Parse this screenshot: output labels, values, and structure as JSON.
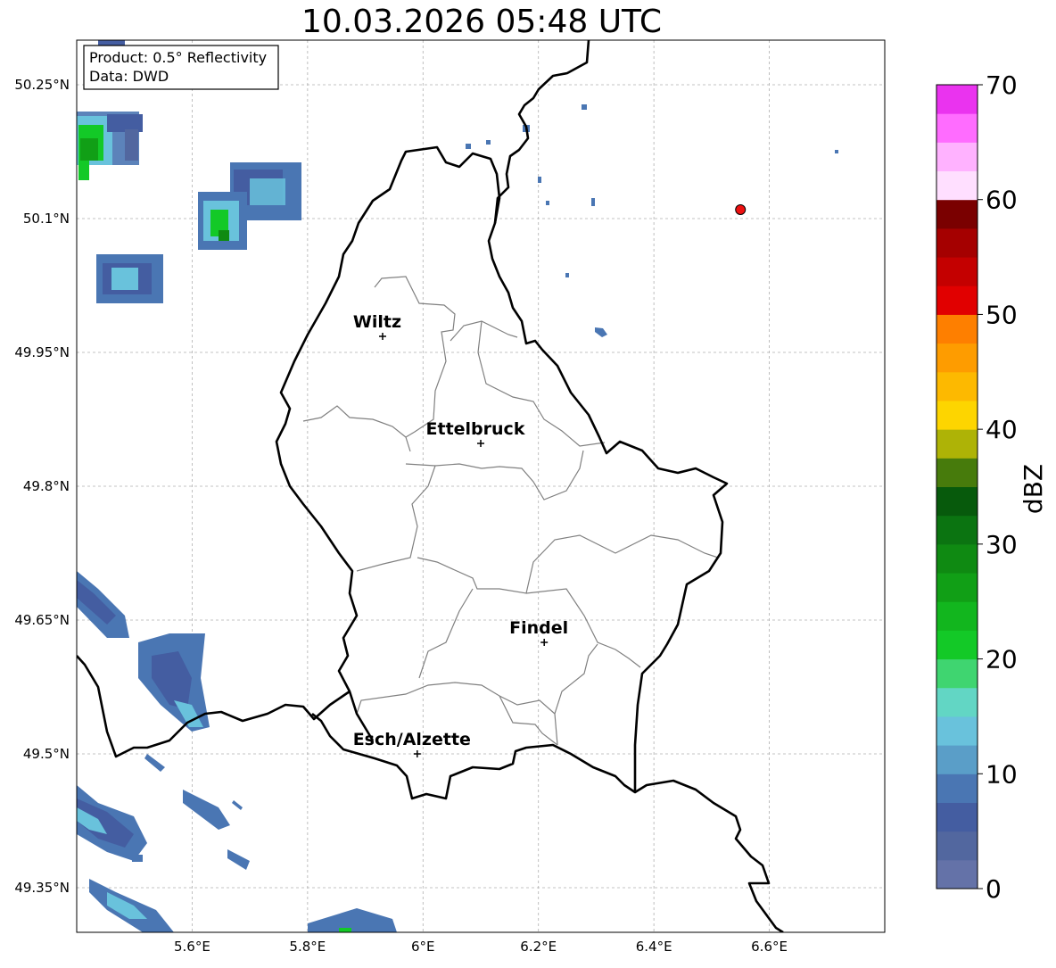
{
  "title": "10.03.2026 05:48 UTC",
  "infobox": {
    "product": "Product: 0.5° Reflectivity",
    "data": "Data: DWD"
  },
  "map": {
    "lon_range": [
      5.4,
      6.8
    ],
    "lat_range": [
      49.3,
      50.3
    ],
    "lon_ticks": [
      {
        "value": 5.6,
        "label": "5.6°E"
      },
      {
        "value": 5.8,
        "label": "5.8°E"
      },
      {
        "value": 6.0,
        "label": "6°E"
      },
      {
        "value": 6.2,
        "label": "6.2°E"
      },
      {
        "value": 6.4,
        "label": "6.4°E"
      },
      {
        "value": 6.6,
        "label": "6.6°E"
      }
    ],
    "lat_ticks": [
      {
        "value": 50.25,
        "label": "50.25°N"
      },
      {
        "value": 50.1,
        "label": "50.1°N"
      },
      {
        "value": 49.95,
        "label": "49.95°N"
      },
      {
        "value": 49.8,
        "label": "49.8°N"
      },
      {
        "value": 49.65,
        "label": "49.65°N"
      },
      {
        "value": 49.5,
        "label": "49.5°N"
      },
      {
        "value": 49.35,
        "label": "49.35°N"
      }
    ],
    "grid": true,
    "cities": [
      {
        "name": "Wiltz",
        "lon": 5.93,
        "lat": 49.968
      },
      {
        "name": "Ettelbruck",
        "lon": 6.1,
        "lat": 49.848
      },
      {
        "name": "Findel",
        "lon": 6.21,
        "lat": 49.625
      },
      {
        "name": "Esch/Alzette",
        "lon": 5.99,
        "lat": 49.5
      }
    ],
    "marker": {
      "lon": 6.55,
      "lat": 50.11,
      "color": "#ee1111"
    }
  },
  "colorbar": {
    "label": "dBZ",
    "ticks": [
      0,
      10,
      20,
      30,
      40,
      50,
      60,
      70
    ],
    "min": 0,
    "max": 70,
    "colors": [
      "#6472a8",
      "#52679f",
      "#445da1",
      "#4a76b3",
      "#5a9ec8",
      "#69c2dc",
      "#62d6c4",
      "#3fd570",
      "#13c927",
      "#12b61e",
      "#119f16",
      "#0f8a12",
      "#0b7411",
      "#075a0c",
      "#477b0c",
      "#aeb306",
      "#fdd500",
      "#fdb900",
      "#fe9c00",
      "#fe7f00",
      "#e10000",
      "#c40000",
      "#a50000",
      "#7a0000",
      "#ffdfff",
      "#ffb2ff",
      "#ff6cff",
      "#ea33ef"
    ]
  }
}
